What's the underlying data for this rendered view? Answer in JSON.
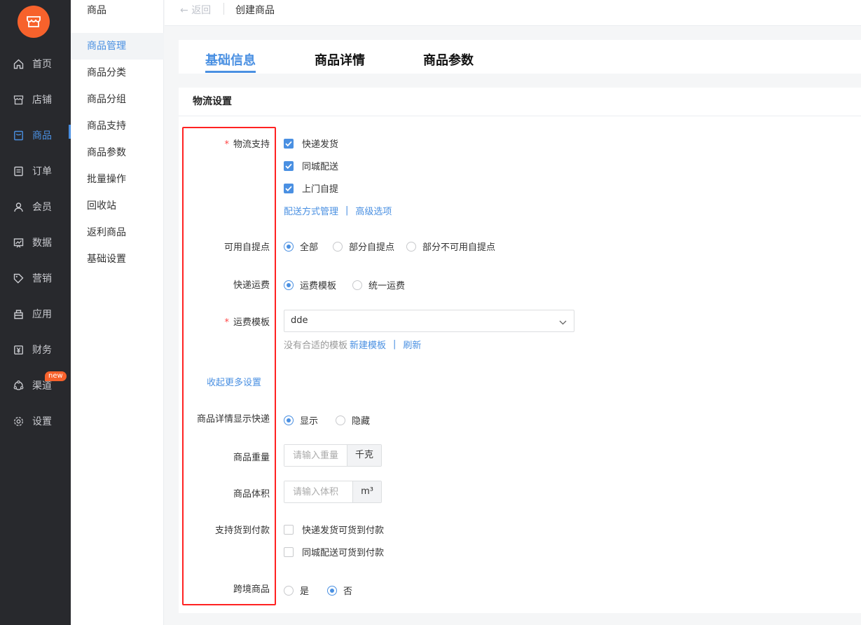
{
  "sidebar": {
    "items": [
      {
        "label": "首页",
        "icon": "home-icon"
      },
      {
        "label": "店铺",
        "icon": "store-icon"
      },
      {
        "label": "商品",
        "icon": "goods-icon",
        "active": true
      },
      {
        "label": "订单",
        "icon": "order-icon"
      },
      {
        "label": "会员",
        "icon": "member-icon"
      },
      {
        "label": "数据",
        "icon": "chart-icon"
      },
      {
        "label": "营销",
        "icon": "tag-icon"
      },
      {
        "label": "应用",
        "icon": "app-icon"
      },
      {
        "label": "财务",
        "icon": "yen-icon"
      },
      {
        "label": "渠道",
        "icon": "channel-icon",
        "badge": "new"
      },
      {
        "label": "设置",
        "icon": "gear-icon"
      }
    ]
  },
  "subnav": {
    "title": "商品",
    "items": [
      "商品管理",
      "商品分类",
      "商品分组",
      "商品支持",
      "商品参数",
      "批量操作",
      "回收站",
      "返利商品",
      "基础设置"
    ]
  },
  "topbar": {
    "back": "返回",
    "breadcrumb": "创建商品"
  },
  "tabs": [
    "基础信息",
    "商品详情",
    "商品参数"
  ],
  "section": {
    "title": "物流设置"
  },
  "form": {
    "logistics": {
      "label": "物流支持",
      "options": [
        "快递发货",
        "同城配送",
        "上门自提"
      ],
      "link1": "配送方式管理",
      "link2": "高级选项"
    },
    "pickup": {
      "label": "可用自提点",
      "options": [
        "全部",
        "部分自提点",
        "部分不可用自提点"
      ]
    },
    "shipping_fee": {
      "label": "快递运费",
      "options": [
        "运费模板",
        "统一运费"
      ]
    },
    "template": {
      "label": "运费模板",
      "value": "dde",
      "hint": "没有合适的模板",
      "new_link": "新建模板",
      "refresh_link": "刷新"
    },
    "collapse_link": "收起更多设置",
    "show_express": {
      "label": "商品详情显示快递",
      "options": [
        "显示",
        "隐藏"
      ]
    },
    "weight": {
      "label": "商品重量",
      "placeholder": "请输入重量",
      "unit": "千克"
    },
    "volume": {
      "label": "商品体积",
      "placeholder": "请输入体积",
      "unit": "m³"
    },
    "cod": {
      "label": "支持货到付款",
      "options": [
        "快递发货可货到付款",
        "同城配送可货到付款"
      ]
    },
    "cross_border": {
      "label": "跨境商品",
      "options": [
        "是",
        "否"
      ]
    }
  },
  "colors": {
    "accent": "#4a90e2",
    "brand": "#f7622c",
    "sidebar_bg": "#28292d",
    "required": "#f44",
    "highlight_box": "#f22"
  }
}
